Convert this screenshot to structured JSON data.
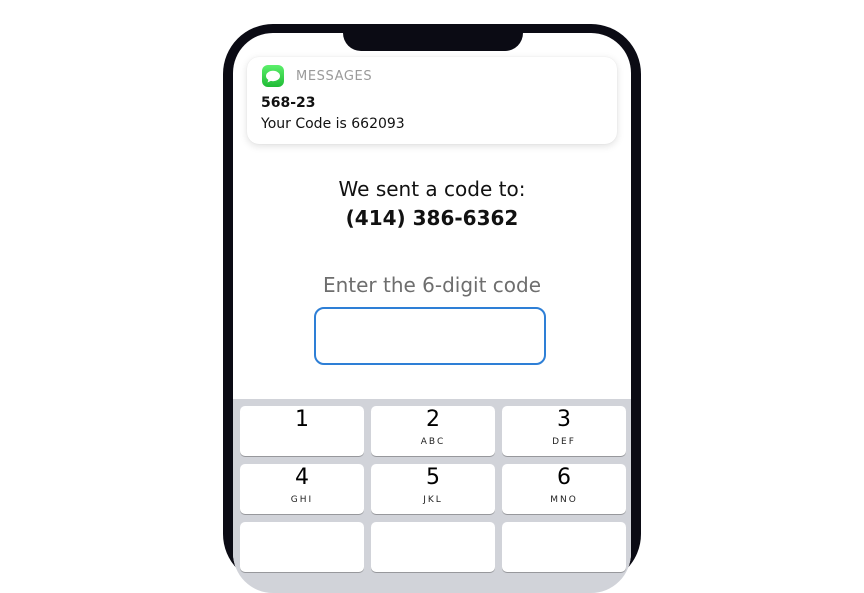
{
  "notification": {
    "app_name": "MESSAGES",
    "sender": "568-23",
    "message": "Your Code is 662093"
  },
  "verification": {
    "sent_text": "We sent a code to:",
    "phone_number": "(414) 386-6362",
    "prompt": "Enter the 6-digit code",
    "code_value": ""
  },
  "keypad": {
    "keys": [
      {
        "digit": "1",
        "letters": ""
      },
      {
        "digit": "2",
        "letters": "ABC"
      },
      {
        "digit": "3",
        "letters": "DEF"
      },
      {
        "digit": "4",
        "letters": "GHI"
      },
      {
        "digit": "5",
        "letters": "JKL"
      },
      {
        "digit": "6",
        "letters": "MNO"
      },
      {
        "digit": "",
        "letters": ""
      },
      {
        "digit": "",
        "letters": ""
      },
      {
        "digit": "",
        "letters": ""
      }
    ]
  },
  "colors": {
    "accent": "#2e7fd6",
    "messages_icon": "#34c759",
    "keypad_background": "#d1d3d9"
  }
}
